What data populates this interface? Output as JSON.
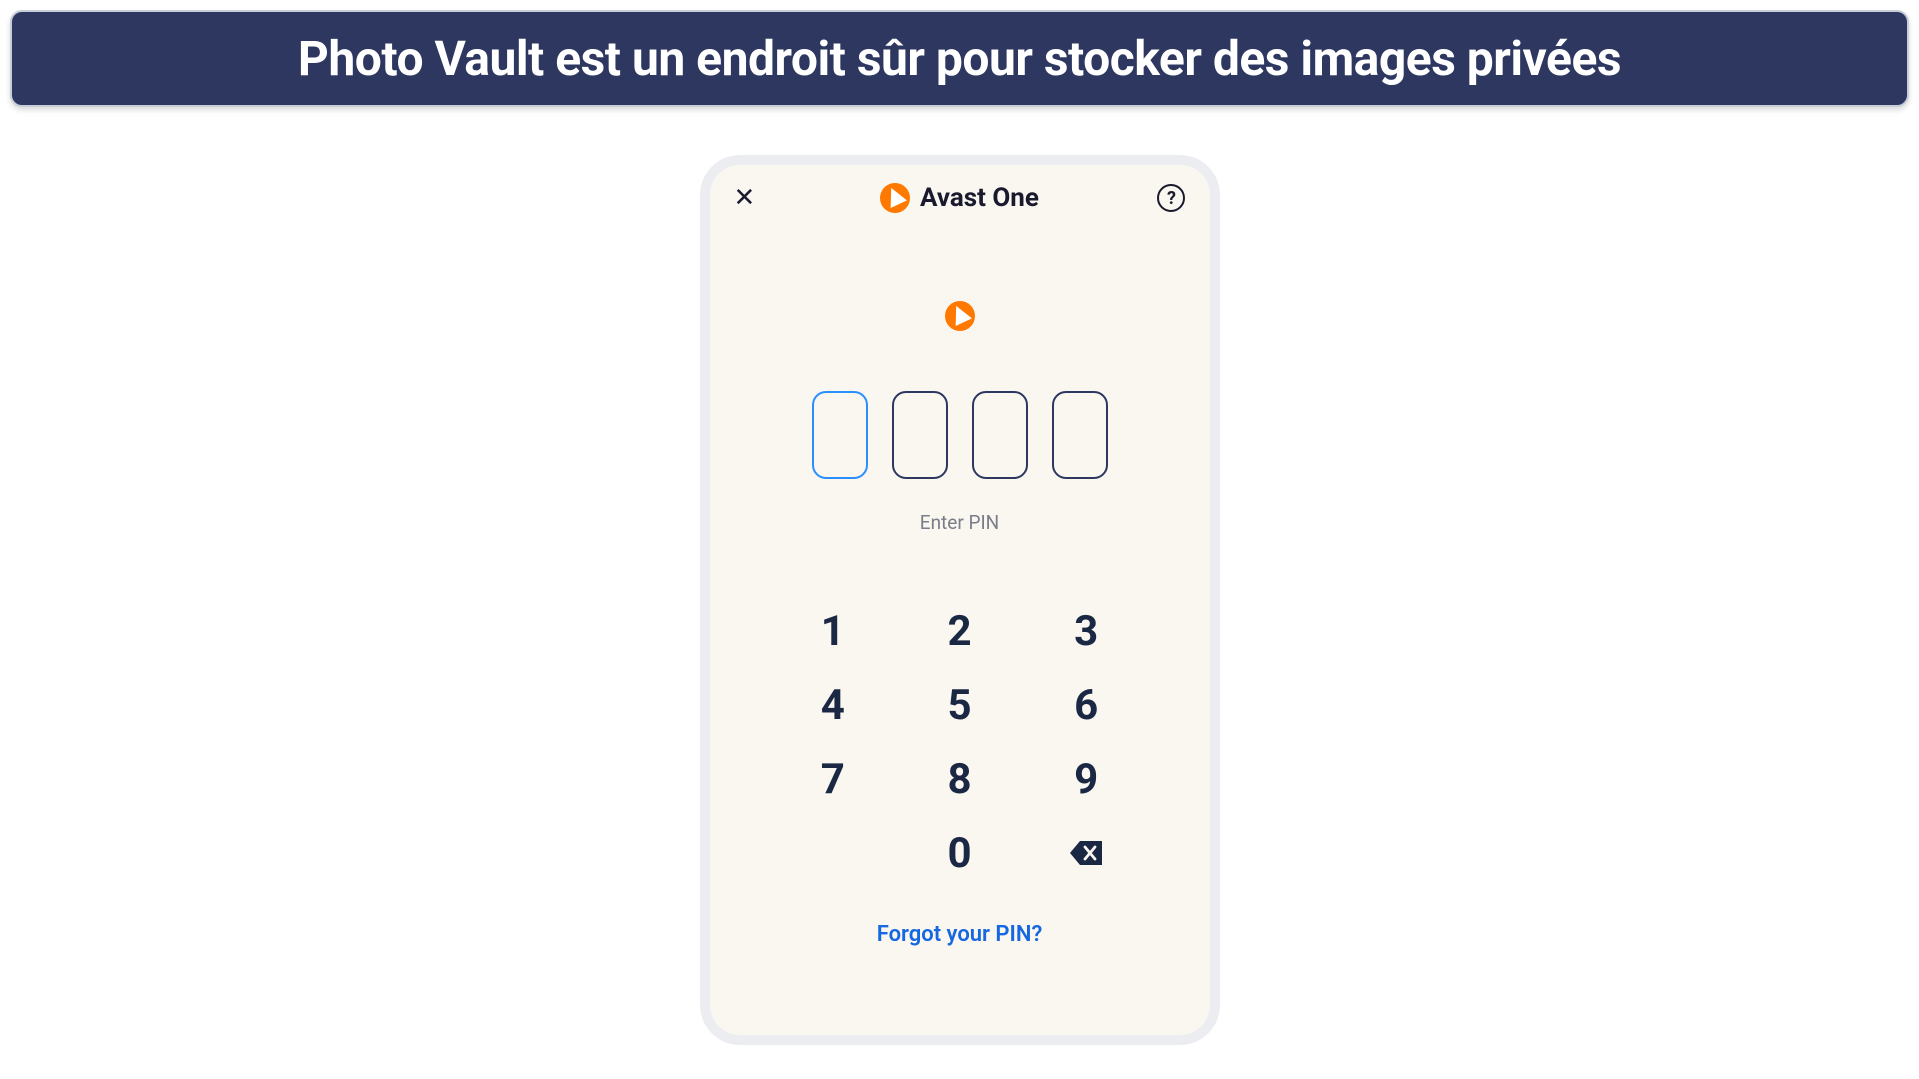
{
  "banner": {
    "text": "Photo Vault est un endroit sûr pour stocker des images privées"
  },
  "header": {
    "app_name": "Avast One"
  },
  "pin_entry": {
    "label": "Enter PIN",
    "forgot_link": "Forgot your PIN?"
  },
  "keypad": {
    "keys": [
      "1",
      "2",
      "3",
      "4",
      "5",
      "6",
      "7",
      "8",
      "9",
      "",
      "0"
    ]
  }
}
